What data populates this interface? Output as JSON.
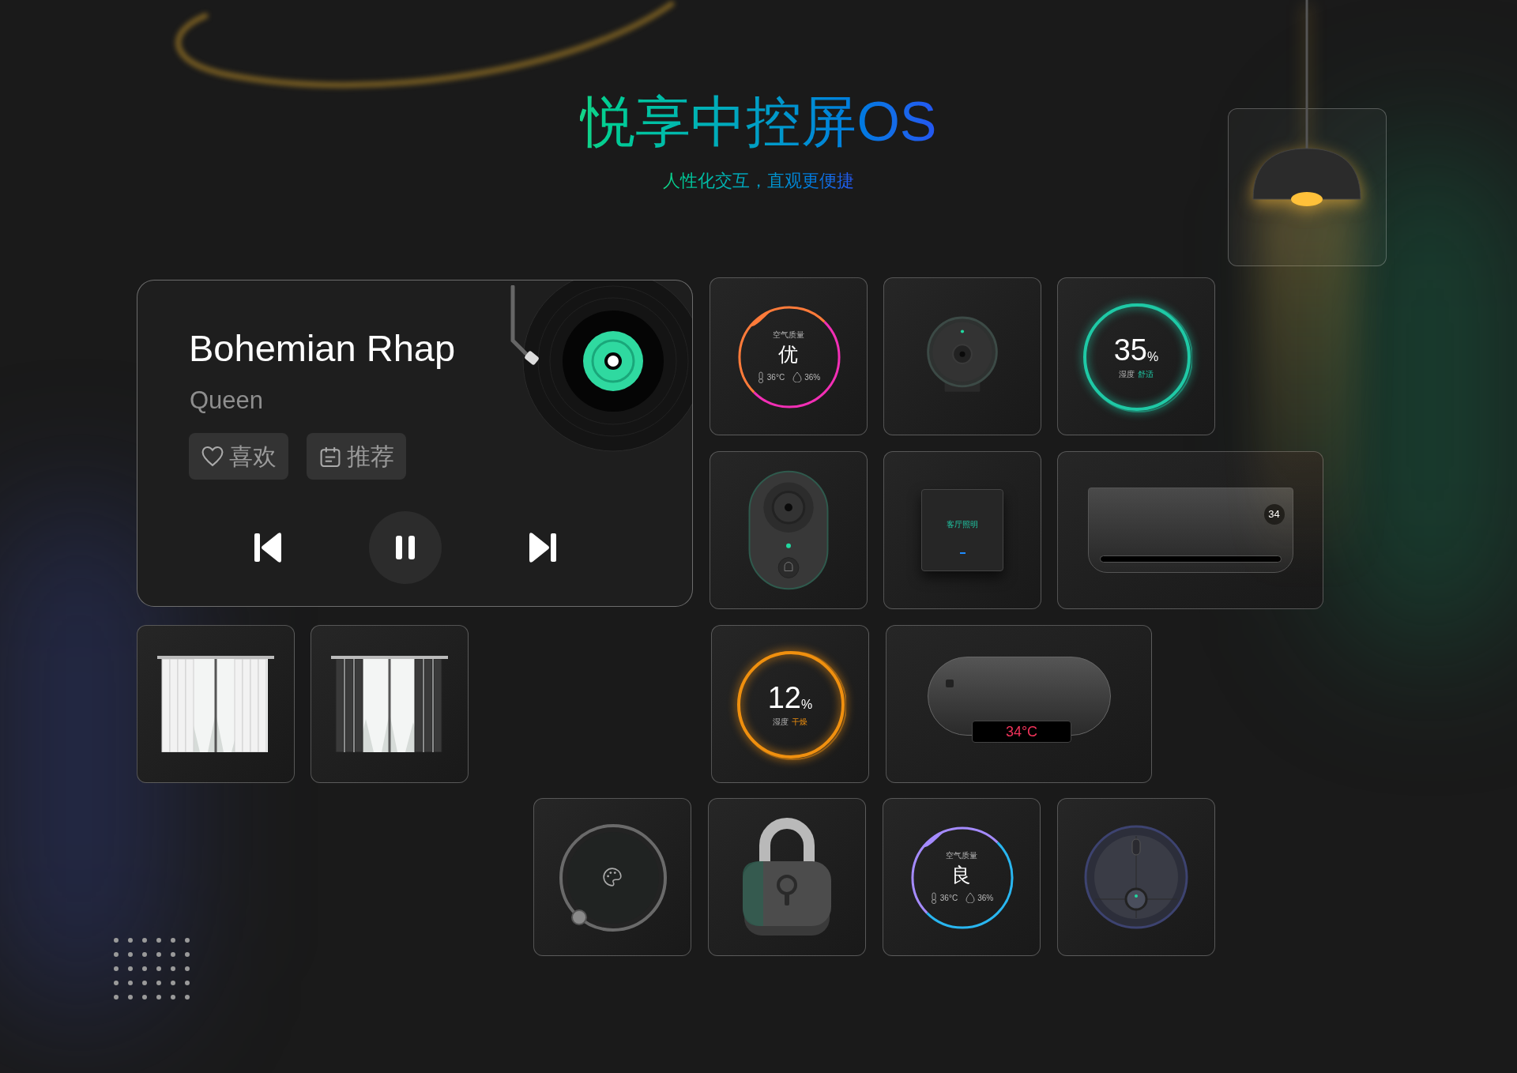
{
  "header": {
    "title": "悦享中控屏OS",
    "subtitle": "人性化交互，直观更便捷"
  },
  "lamp": {
    "on": true
  },
  "music_player": {
    "song": "Bohemian Rhap",
    "artist": "Queen",
    "playing": true,
    "actions": [
      {
        "kind": "like",
        "label": "喜欢"
      },
      {
        "kind": "recommend",
        "label": "推荐"
      }
    ]
  },
  "devices": [
    {
      "kind": "air_quality",
      "label": "空气质量",
      "value": "优",
      "temperature": "36°C",
      "humidity": "36%",
      "ring_segments": [
        {
          "color": "#ff7b3a"
        },
        {
          "color": "#f22fb5"
        }
      ]
    },
    {
      "kind": "camera"
    },
    {
      "kind": "humidity",
      "value": "35",
      "unit": "%",
      "label": "湿度",
      "status": "舒适",
      "color": "#1fc9a6"
    },
    {
      "kind": "doorbell"
    },
    {
      "kind": "switch",
      "label": "客厅照明"
    },
    {
      "kind": "air_conditioner",
      "display": "34"
    },
    {
      "kind": "sheer_curtain"
    },
    {
      "kind": "blackout_curtain"
    },
    {
      "kind": "humidity",
      "value": "12",
      "unit": "%",
      "label": "湿度",
      "status": "干燥",
      "color": "#f0900f"
    },
    {
      "kind": "water_heater",
      "display": "34°C"
    },
    {
      "kind": "dial"
    },
    {
      "kind": "lock"
    },
    {
      "kind": "air_quality",
      "label": "空气质量",
      "value": "良",
      "temperature": "36°C",
      "humidity": "36%",
      "ring_segments": [
        {
          "color": "#a58bff"
        },
        {
          "color": "#29b6f0"
        }
      ]
    },
    {
      "kind": "robot_vacuum"
    }
  ]
}
